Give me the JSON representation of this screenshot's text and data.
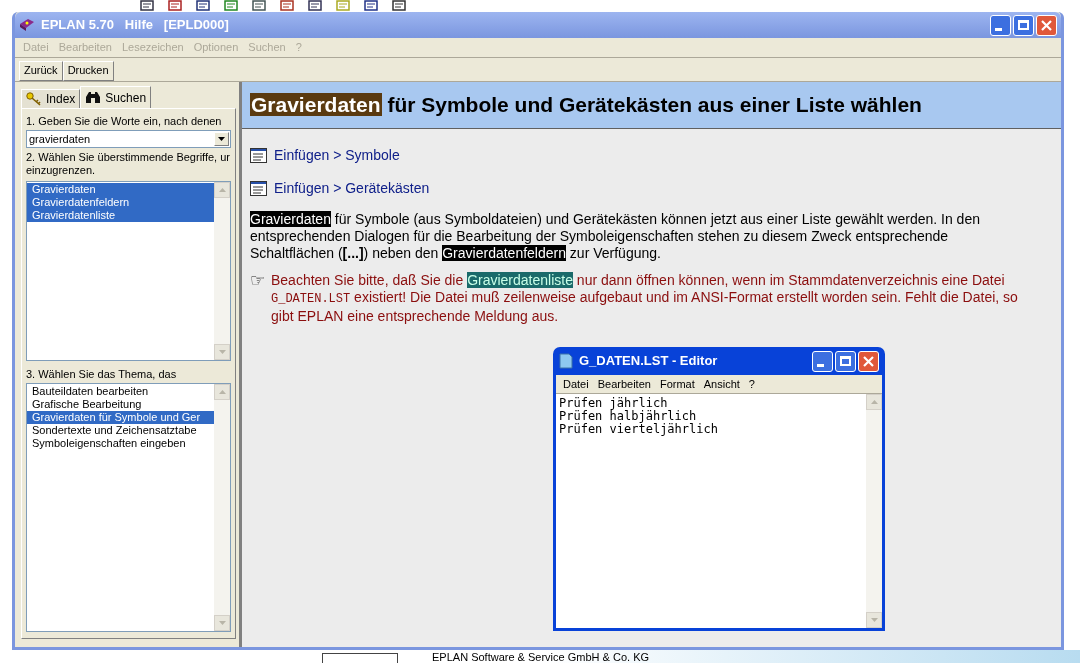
{
  "desktop": {
    "footer_text": "EPLAN Software & Service GmbH & Co. KG"
  },
  "window": {
    "title": "EPLAN 5.70   Hilfe   [EPLD000]"
  },
  "menu": [
    {
      "label": "Datei",
      "disabled": true
    },
    {
      "label": "Bearbeiten",
      "disabled": true
    },
    {
      "label": "Lesezeichen",
      "disabled": true
    },
    {
      "label": "Optionen",
      "disabled": true
    },
    {
      "label": "Suchen",
      "disabled": true
    },
    {
      "label": "?",
      "disabled": true
    }
  ],
  "toolbar": [
    "Zurück",
    "Drucken"
  ],
  "sidebar": {
    "tabs": [
      {
        "label": "Index",
        "kind": "key",
        "selected": false
      },
      {
        "label": "Suchen",
        "kind": "binoculars",
        "selected": true
      }
    ],
    "step1_label": "1. Geben Sie die Worte ein, nach denen",
    "search_field": {
      "value": "gravierdaten"
    },
    "step2_lines": [
      "2. Wählen Sie überstimmende Begriffe, ur",
      "einzugrenzen."
    ],
    "terms": [
      {
        "label": "Gravierdaten",
        "selected": true
      },
      {
        "label": "Gravierdatenfeldern",
        "selected": true
      },
      {
        "label": "Gravierdatenliste",
        "selected": true
      }
    ],
    "step3_label": "3. Wählen Sie das Thema, das",
    "topics": [
      {
        "label": "Bauteildaten bearbeiten",
        "selected": false
      },
      {
        "label": "Grafische Bearbeitung",
        "selected": false
      },
      {
        "label": "Gravierdaten für Symbole und Ger",
        "selected": true
      },
      {
        "label": "Sondertexte und Zeichensatztabe",
        "selected": false
      },
      {
        "label": "Symboleigenschaften eingeben",
        "selected": false
      }
    ]
  },
  "content": {
    "heading": [
      {
        "kind": "highlight",
        "text": "Gravierdaten"
      },
      {
        "kind": "plain",
        "text": " für Symbole und Gerätekästen aus einer Liste wählen"
      }
    ],
    "links": [
      "Einfügen > Symbole",
      "Einfügen > Gerätekästen"
    ],
    "paragraph": [
      {
        "kind": "highlight",
        "text": "Gravierdaten"
      },
      {
        "kind": "plain",
        "text": " für Symbole (aus Symboldateien) und Gerätekästen können jetzt aus einer Liste gewählt werden. In den entsprechenden Dialogen für die Bearbeitung der Symboleigenschaften stehen zu diesem Zweck entsprechende Schaltflächen ("
      },
      {
        "kind": "bold",
        "text": "[...]"
      },
      {
        "kind": "plain",
        "text": ") neben den "
      },
      {
        "kind": "highlight",
        "text": "Gravierdatenfeldern"
      },
      {
        "kind": "plain",
        "text": " zur Verfügung."
      }
    ],
    "notice": {
      "icon": "☞",
      "segments": [
        {
          "kind": "plain",
          "text": "Beachten Sie bitte, daß Sie die "
        },
        {
          "kind": "highlight",
          "text": "Gravierdatenliste"
        },
        {
          "kind": "plain",
          "text": " nur dann öffnen können, wenn im Stammdatenverzeichnis eine Datei "
        },
        {
          "kind": "code",
          "text": "G_DATEN.LST"
        },
        {
          "kind": "plain",
          "text": " existiert! Die Datei muß zeilenweise aufgebaut und im ANSI-Format erstellt worden sein. Fehlt die Datei, so gibt EPLAN eine entsprechende Meldung aus."
        }
      ]
    },
    "editor": {
      "title": "G_DATEN.LST - Editor",
      "menu": [
        "Datei",
        "Bearbeiten",
        "Format",
        "Ansicht",
        "?"
      ],
      "lines": [
        "Prüfen jährlich",
        "Prüfen halbjährlich",
        "Prüfen vierteljährlich"
      ]
    }
  }
}
